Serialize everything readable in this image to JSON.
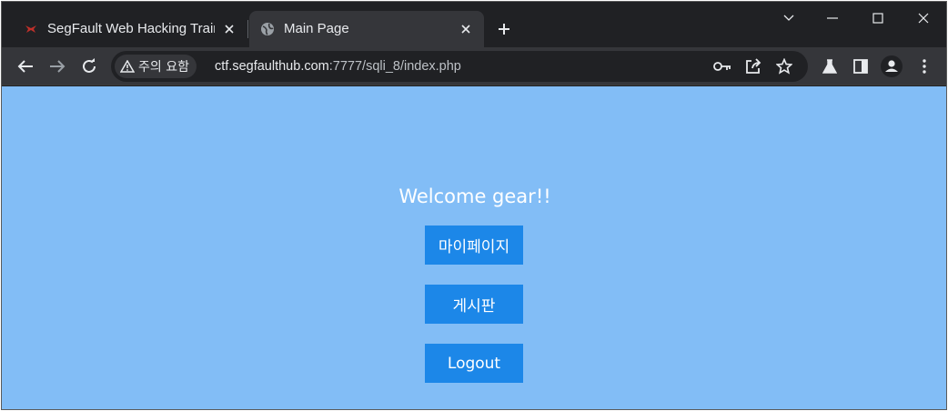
{
  "browser": {
    "tabs": [
      {
        "title": "SegFault Web Hacking Training",
        "active": false,
        "favicon": "segfault-logo-icon"
      },
      {
        "title": "Main Page",
        "active": true,
        "favicon": "globe-icon"
      }
    ],
    "address_bar": {
      "security_chip": "주의 요함",
      "url_host": "ctf.segfaulthub.com",
      "url_path": ":7777/sqli_8/index.php"
    }
  },
  "page": {
    "welcome": "Welcome gear!!",
    "buttons": [
      {
        "label": "마이페이지"
      },
      {
        "label": "게시판"
      },
      {
        "label": "Logout"
      }
    ]
  },
  "colors": {
    "page_background": "#82bdf6",
    "button_background": "#1c87e8",
    "chrome_dark": "#202124",
    "chrome_toolbar": "#35363a"
  }
}
